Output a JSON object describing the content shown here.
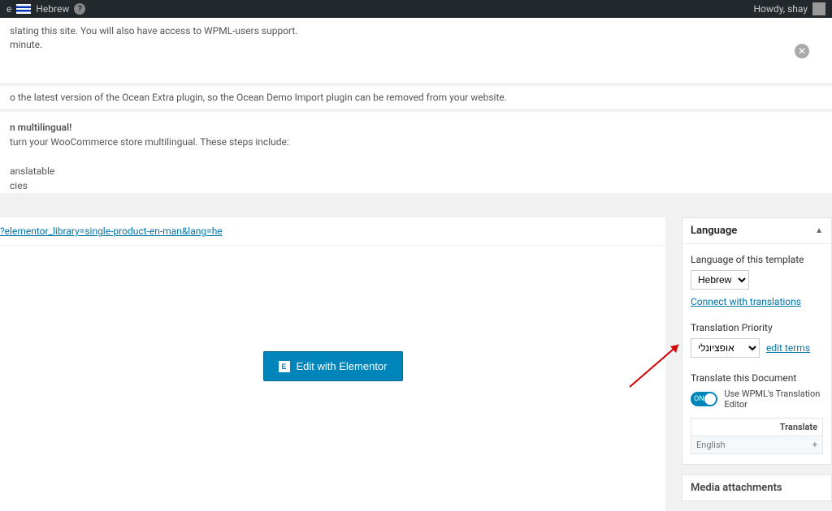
{
  "adminbar": {
    "left_fragment": "e",
    "language_label": "Hebrew",
    "help_glyph": "?",
    "howdy": "Howdy, shay"
  },
  "notices": {
    "n1_line1": "slating this site. You will also have access to WPML-users support.",
    "n1_line2": "minute.",
    "n2": "o the latest version of the Ocean Extra plugin, so the Ocean Demo Import plugin can be removed from your website.",
    "n3_title": "n multilingual!",
    "n3_line": "turn your WooCommerce store multilingual. These steps include:",
    "n3_b1": "anslatable",
    "n3_b2": "cies"
  },
  "url_line": "?elementor_library=single-product-en-man&lang=he",
  "edit_button": "Edit with Elementor",
  "language_panel": {
    "title": "Language",
    "lang_of_template": "Language of this template",
    "lang_value": "Hebrew",
    "connect_link": "Connect with translations",
    "priority_label": "Translation Priority",
    "priority_value": "אופציונלי",
    "edit_terms": "edit terms",
    "translate_doc": "Translate this Document",
    "toggle_on": "ON",
    "toggle_label": "Use WPML's Translation Editor",
    "table_header": "Translate",
    "table_lang": "English",
    "plus": "+"
  },
  "media_attachments": "Media attachments"
}
